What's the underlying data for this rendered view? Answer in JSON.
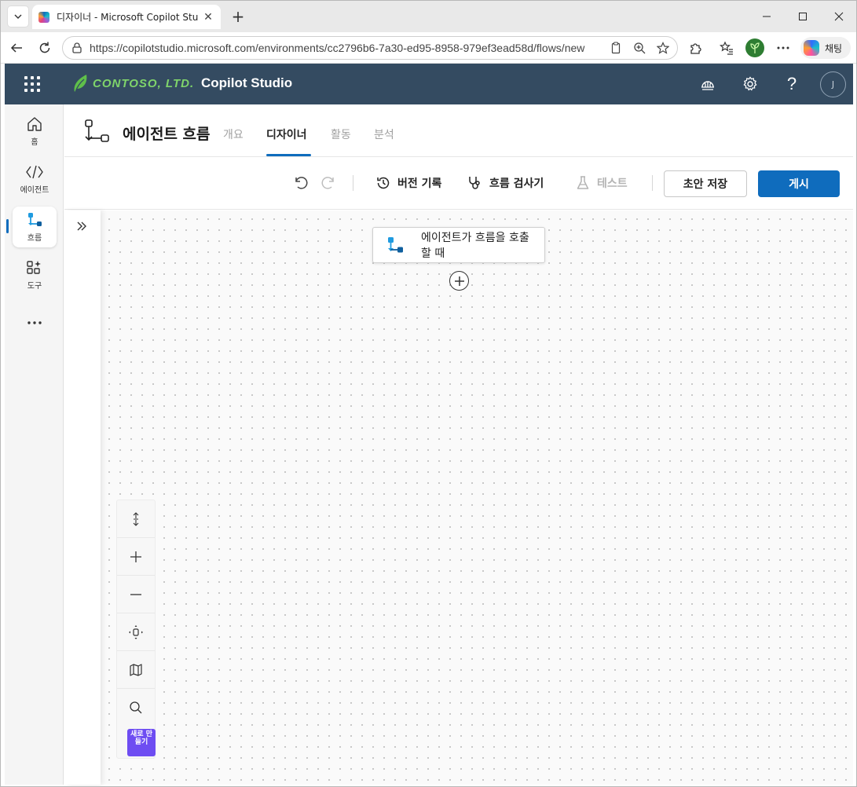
{
  "browser": {
    "tab_title": "디자이너 - Microsoft Copilot Studio",
    "url": "https://copilotstudio.microsoft.com/environments/cc2796b6-7a30-ed95-8958-979ef3ead58d/flows/new",
    "chat_label": "채팅"
  },
  "header": {
    "brand_name": "CONTOSO, LTD.",
    "product_name": "Copilot Studio",
    "avatar_initial": "J",
    "colors": {
      "header_bg": "#344b61",
      "brand_green": "#7fd46b"
    }
  },
  "rail": {
    "items": [
      {
        "label": "홈",
        "icon": "home-icon"
      },
      {
        "label": "에이전트",
        "icon": "agent-code-icon"
      },
      {
        "label": "흐름",
        "icon": "flow-icon",
        "active": true
      },
      {
        "label": "도구",
        "icon": "tools-icon"
      }
    ],
    "more_label": "..."
  },
  "page": {
    "title": "에이전트 흐름",
    "tabs": [
      {
        "label": "개요",
        "active": false
      },
      {
        "label": "디자이너",
        "active": true
      },
      {
        "label": "활동",
        "active": false
      },
      {
        "label": "분석",
        "active": false
      }
    ]
  },
  "toolbar": {
    "version_history": "버전 기록",
    "flow_checker": "흐름 검사기",
    "test": "테스트",
    "save_draft": "초안 저장",
    "publish": "게시",
    "accent": "#0f6cbd"
  },
  "canvas": {
    "trigger_node_label": "에이전트가 흐름을 호출할 때",
    "new_badge": "새로 만들기"
  }
}
